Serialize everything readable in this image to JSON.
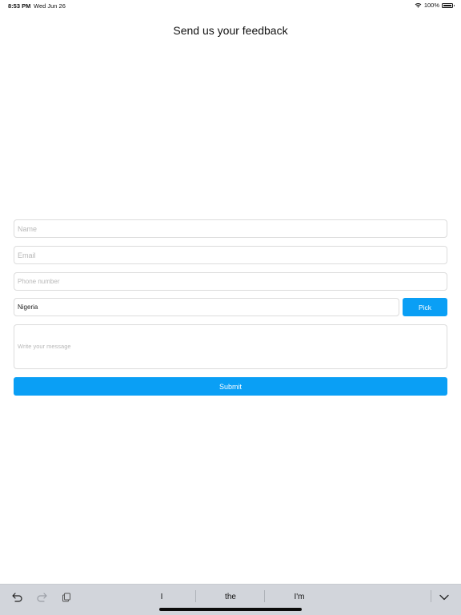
{
  "status_bar": {
    "time": "8:53 PM",
    "date": "Wed Jun 26",
    "battery": "100%",
    "icons": [
      "wifi-icon",
      "battery-icon"
    ]
  },
  "page": {
    "title": "Send us your feedback"
  },
  "form": {
    "name_placeholder": "Name",
    "email_placeholder": "Email",
    "phone_placeholder": "Phone number",
    "country_value": "Nigeria",
    "pick_label": "Pick",
    "message_placeholder": "Write your message",
    "submit_label": "Submit"
  },
  "keyboard_bar": {
    "suggestions": [
      "I",
      "the",
      "I'm"
    ],
    "icons": [
      "undo-icon",
      "redo-icon",
      "paste-icon",
      "chevron-down-icon"
    ]
  },
  "colors": {
    "accent": "#0a9ff5",
    "keyboard_bg": "#d2d5db",
    "field_border": "#dcdcdc"
  }
}
